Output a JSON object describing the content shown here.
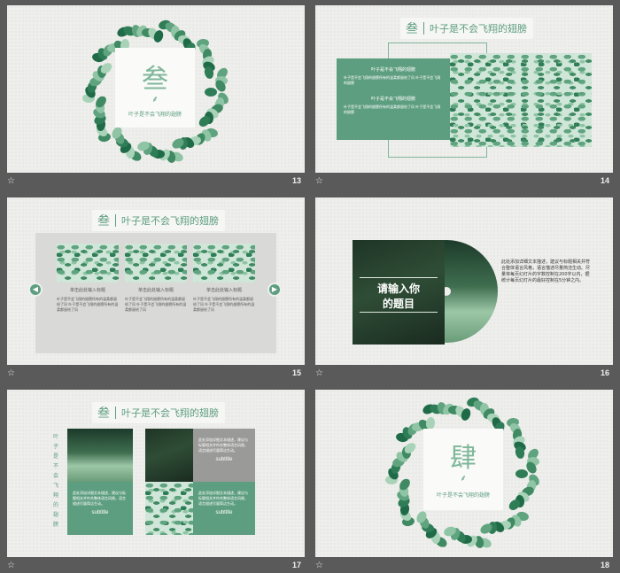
{
  "star_glyph": "☆",
  "accent": "#5e9e80",
  "slides": [
    {
      "number": "13",
      "big_char": "叁",
      "caption": "叶子是不会飞翔的翅膀"
    },
    {
      "number": "14",
      "lead": "叁",
      "title": "叶子是不会飞翔的翅膀",
      "blocks": [
        {
          "heading": "叶子是不会飞翔的翅膀",
          "body": "叶子是不会飞翔的翅膀所有的温柔都留给了风 叶子是不会飞翔的翅膀"
        },
        {
          "heading": "叶子是不会飞翔的翅膀",
          "body": "叶子是不会飞翔的翅膀所有的温柔都留给了风 叶子是不会飞翔的翅膀"
        }
      ]
    },
    {
      "number": "15",
      "lead": "叁",
      "title": "叶子是不会飞翔的翅膀",
      "cards": [
        {
          "heading": "单击此处输入标题",
          "body": "叶子是不会飞翔的翅膀所有的温柔都留给了风 叶子是不会飞翔的翅膀所有的温柔都留给了风"
        },
        {
          "heading": "单击此处输入标题",
          "body": "叶子是不会飞翔的翅膀所有的温柔都留给了风 叶子是不会飞翔的翅膀所有的温柔都留给了风"
        },
        {
          "heading": "单击此处输入标题",
          "body": "叶子是不会飞翔的翅膀所有的温柔都留给了风 叶子是不会飞翔的翅膀所有的温柔都留给了风"
        }
      ]
    },
    {
      "number": "16",
      "headline_line1": "请输入你",
      "headline_line2": "的题目",
      "body": "此处添加详细文本描述，建议与标题相关并符合整体语言风格，语言描述尽量简洁生动。尽量将每页幻灯片的字数控制在200字以内，据统计每页幻灯片的最好控制在5分钟之内。"
    },
    {
      "number": "17",
      "lead": "叁",
      "title": "叶子是不会飞翔的翅膀",
      "vertical_text": "叶子是不会飞翔的翅膀",
      "blocks": [
        {
          "body": "此处添加详细文本描述，建议与标题相关并符合整体语言风格，语言描述尽量简洁生动。"
        },
        {
          "body": "此处添加详细文本描述，建议与标题相关并符合整体语言风格，语言描述尽量简洁生动。",
          "label": "subtitle"
        },
        {
          "body": "此处添加详细文本描述，建议与标题相关并符合整体语言风格，语言描述尽量简洁生动。",
          "label": "subtitle"
        },
        {
          "body": "此处添加详细文本描述，建议与标题相关并符合整体语言风格，语言描述尽量简洁生动。",
          "label": "subtitle"
        }
      ]
    },
    {
      "number": "18",
      "big_char": "肆",
      "caption": "叶子是不会飞翔的翅膀"
    }
  ]
}
